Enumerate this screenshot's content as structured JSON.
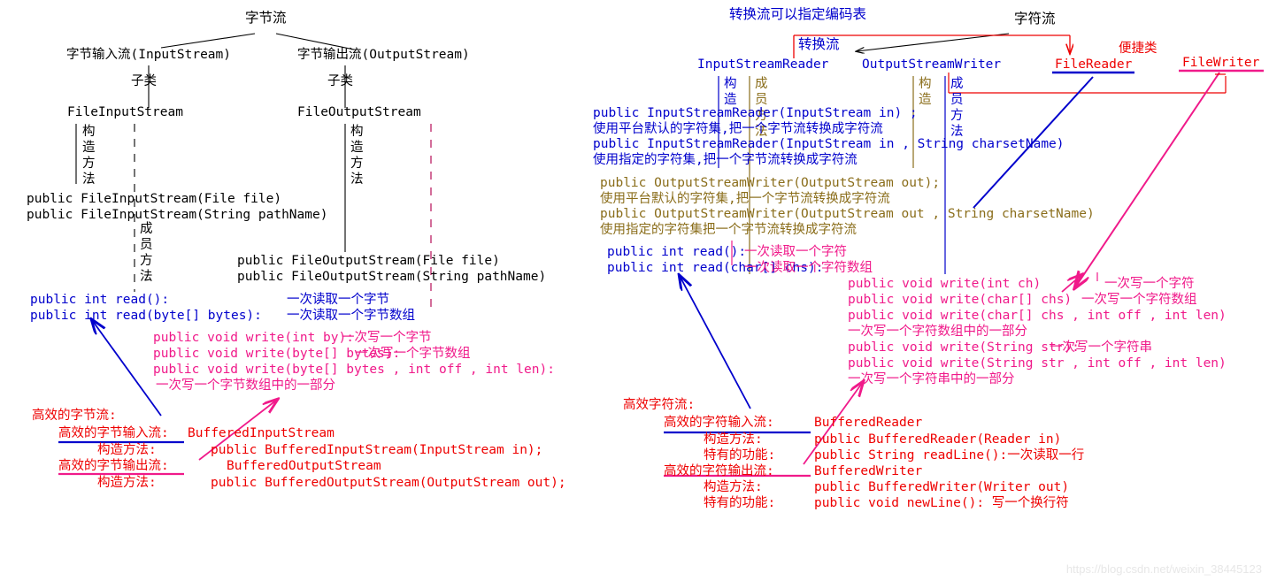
{
  "watermark": "https://blog.csdn.net/weixin_38445123",
  "left": {
    "root": "字节流",
    "input_node": "字节输入流(InputStream)",
    "output_node": "字节输出流(OutputStream)",
    "subclass_label_1": "子类",
    "subclass_label_2": "子类",
    "file_input": "FileInputStream",
    "file_output": "FileOutputStream",
    "vlabel_ctor_1": [
      "构",
      "造",
      "方",
      "法"
    ],
    "vlabel_ctor_2": [
      "构",
      "造",
      "方",
      "法"
    ],
    "vlabel_member_1": [
      "成",
      "员",
      "方",
      "法"
    ],
    "fis_ctor_1": "public FileInputStream(File file)",
    "fis_ctor_2": "public FileInputStream(String pathName)",
    "fos_ctor_1": "public FileOutputStream(File file)",
    "fos_ctor_2": "public FileOutputStream(String pathName)",
    "read_1_sig": "public int read():",
    "read_1_note": "一次读取一个字节",
    "read_2_sig": "public int read(byte[] bytes):",
    "read_2_note": "一次读取一个字节数组",
    "write_1": "public void write(int by):",
    "write_1_note": "一次写一个字节",
    "write_2": "public void write(byte[] bytes):",
    "write_2_note": "一次写一个字节数组",
    "write_3": "public void write(byte[] bytes , int off , int len):",
    "write_3_note": "一次写一个字节数组中的一部分",
    "buffered_title": "高效的字节流:",
    "buffered_in_label": "高效的字节输入流:",
    "buffered_in_class": "BufferedInputStream",
    "buffered_in_ctor_label": "构造方法:",
    "buffered_in_ctor": "public BufferedInputStream(InputStream in);",
    "buffered_out_label": "高效的字节输出流:",
    "buffered_out_class": "BufferedOutputStream",
    "buffered_out_ctor_label": "构造方法:",
    "buffered_out_ctor": "public BufferedOutputStream(OutputStream out);"
  },
  "right": {
    "note_encoding": "转换流可以指定编码表",
    "root": "字符流",
    "convert_label": "转换流",
    "convenience_label": "便捷类",
    "isr": "InputStreamReader",
    "osw": "OutputStreamWriter",
    "file_reader": "FileReader",
    "file_writer": "FileWriter",
    "vlabel_ctor_1": [
      "构",
      "造"
    ],
    "vlabel_member_1": [
      "成",
      "员",
      "方",
      "法"
    ],
    "vlabel_ctor_2": [
      "构",
      "造"
    ],
    "vlabel_member_2": [
      "成",
      "员",
      "方",
      "法"
    ],
    "isr_ctor_1": "public InputStreamReader(InputStream in) ;",
    "isr_ctor_1_note": "使用平台默认的字符集,把一个字节流转换成字符流",
    "isr_ctor_2": "public InputStreamReader(InputStream in , String charsetName)",
    "isr_ctor_2_note": "使用指定的字符集,把一个字节流转换成字符流",
    "osw_ctor_1": "public OutputStreamWriter(OutputStream out);",
    "osw_ctor_1_note": "使用平台默认的字符集,把一个字节流转换成字符流",
    "osw_ctor_2": "public OutputStreamWriter(OutputStream out , String charsetName)",
    "osw_ctor_2_note": "使用指定的字符集把一个字节流转换成字符流",
    "read_1_sig": "public int read():",
    "read_1_note": "一次读取一个字符",
    "read_2_sig": "public int read(char[] chs):",
    "read_2_note": "一次读取一个字符数组",
    "write_1": "public void write(int ch)",
    "write_1_note": "一次写一个字符",
    "write_2": "public void write(char[] chs)",
    "write_2_note": "一次写一个字符数组",
    "write_3": "public void write(char[] chs , int off , int len)",
    "write_3_note": "一次写一个字符数组中的一部分",
    "write_4": "public void write(String str):",
    "write_4_note": "一次写一个字符串",
    "write_5": "public void write(String str , int off , int len)",
    "write_5_note": "一次写一个字符串中的一部分",
    "buffered_title": "高效字符流:",
    "buffered_in_label": "高效的字符输入流:",
    "buffered_in_class": "BufferedReader",
    "buffered_in_ctor_label": "构造方法:",
    "buffered_in_ctor": "public BufferedReader(Reader in)",
    "buffered_in_special_label": "特有的功能:",
    "buffered_in_special": "public String readLine():一次读取一行",
    "buffered_out_label": "高效的字符输出流:",
    "buffered_out_class": "BufferedWriter",
    "buffered_out_ctor_label": "构造方法:",
    "buffered_out_ctor": "public BufferedWriter(Writer out)",
    "buffered_out_special_label": "特有的功能:",
    "buffered_out_special": "public void newLine(): 写一个换行符"
  },
  "colors": {
    "black": "#000000",
    "blue": "#0000cc",
    "red": "#ee0000",
    "pink": "#f01a8a",
    "olive": "#8a6d1a"
  }
}
